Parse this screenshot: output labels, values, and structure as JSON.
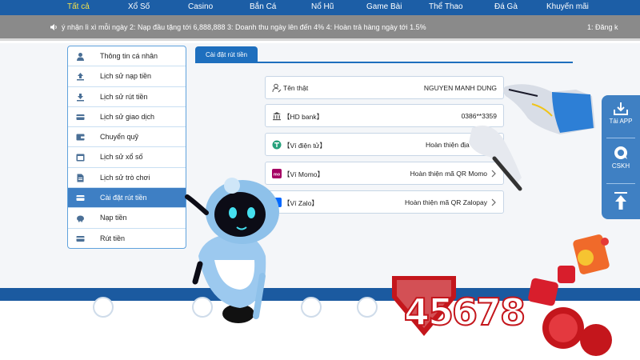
{
  "topnav": {
    "items": [
      {
        "label": "Tất cả",
        "active": true
      },
      {
        "label": "Xổ Số"
      },
      {
        "label": "Casino"
      },
      {
        "label": "Bắn Cá"
      },
      {
        "label": "Nổ Hũ"
      },
      {
        "label": "Game Bài"
      },
      {
        "label": "Thể Thao"
      },
      {
        "label": "Đá Gà"
      },
      {
        "label": "Khuyến mãi"
      }
    ]
  },
  "marquee": {
    "text": "ý nhận lì xì mỗi ngày 2: Nạp đầu tặng tới 6,888,888 3: Doanh thu ngày lên đến 4% 4: Hoàn trả hàng ngày tới 1.5%",
    "text_right": "1: Đăng k"
  },
  "side_menu": {
    "items": [
      {
        "label": "Thông tin cá nhân",
        "icon": "user-icon"
      },
      {
        "label": "Lịch sử nạp tiền",
        "icon": "upload-icon"
      },
      {
        "label": "Lịch sử rút tiền",
        "icon": "download-icon"
      },
      {
        "label": "Lịch sử giao dịch",
        "icon": "card-icon"
      },
      {
        "label": "Chuyển quỹ",
        "icon": "wallet-icon"
      },
      {
        "label": "Lịch sử xổ số",
        "icon": "calendar-icon"
      },
      {
        "label": "Lịch sử trò chơi",
        "icon": "document-icon"
      },
      {
        "label": "Cài đặt rút tiền",
        "icon": "card-icon",
        "active": true
      },
      {
        "label": "Nạp tiền",
        "icon": "piggy-bank-icon"
      },
      {
        "label": "Rút tiền",
        "icon": "card-icon"
      }
    ]
  },
  "main": {
    "tab_label": "Cài đặt rút tiền",
    "rows": [
      {
        "label": "Tên thật",
        "value": "NGUYEN MANH DUNG",
        "icon": "user-edit-icon"
      },
      {
        "label": "【HD bank】",
        "value": "0386**3359",
        "icon": "bank-icon"
      },
      {
        "label": "【Ví điện tử】",
        "value": "Hoàn thiện địa chỉ ví",
        "icon": "tether-icon",
        "chevron": true
      },
      {
        "label": "【Ví Momo】",
        "value": "Hoàn thiện mã QR Momo",
        "icon": "momo-icon",
        "chevron": true
      },
      {
        "label": "【Ví Zalo】",
        "value": "Hoàn thiện mã QR Zalopay",
        "icon": "zalo-icon",
        "chevron": true
      }
    ]
  },
  "float_panel": {
    "items": [
      {
        "label": "Tải APP",
        "icon": "download-app-icon"
      },
      {
        "label": "CSKH",
        "icon": "support-chat-icon"
      },
      {
        "label": "",
        "icon": "arrow-up-icon"
      }
    ]
  },
  "brand": {
    "logo_text": "45678"
  },
  "colors": {
    "nav_bg": "#1c5ea6",
    "active_nav": "#f6e24a",
    "menu_active": "#3e7fc4",
    "brand_red": "#c4161c"
  }
}
